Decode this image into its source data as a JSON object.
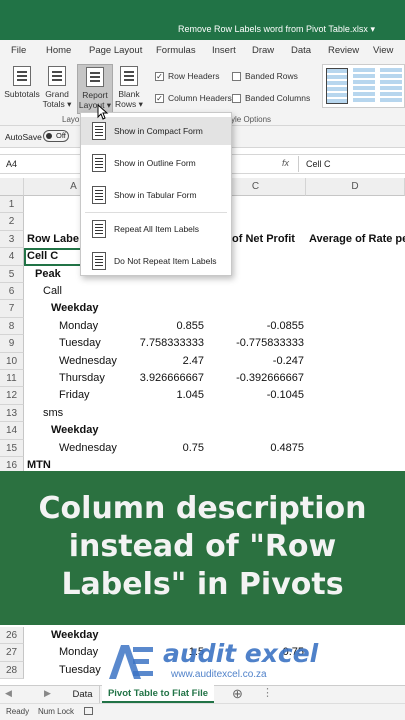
{
  "window": {
    "title": "Remove Row Labels word from Pivot Table.xlsx",
    "title_caret": "▾"
  },
  "menu": [
    "File",
    "Home",
    "Page Layout",
    "Formulas",
    "Insert",
    "Draw",
    "Data",
    "Review",
    "View"
  ],
  "ribbon": {
    "buttons": [
      {
        "line1": "Subtotals",
        "line2": ""
      },
      {
        "line1": "Grand",
        "line2": "Totals ▾"
      },
      {
        "line1": "Report",
        "line2": "Layout ▾"
      },
      {
        "line1": "Blank",
        "line2": "Rows ▾"
      }
    ],
    "layout_group_label": "Layo",
    "options_group_label": "yle Options",
    "checkboxes": [
      {
        "label": "Row Headers",
        "checked": true
      },
      {
        "label": "Banded Rows",
        "checked": false
      },
      {
        "label": "Column Headers",
        "checked": true
      },
      {
        "label": "Banded Columns",
        "checked": false
      }
    ]
  },
  "autosave": {
    "label": "AutoSave",
    "state": "Off"
  },
  "formula_bar": {
    "name_box": "A4",
    "fx": "fx",
    "value": "Cell C"
  },
  "dropdown": {
    "items": [
      "Show in Compact Form",
      "Show in Outline Form",
      "Show in Tabular Form",
      "Repeat All Item Labels",
      "Do Not Repeat Item Labels"
    ]
  },
  "columns": [
    "A",
    "C",
    "D"
  ],
  "rows": [
    {
      "n": "1",
      "a": "",
      "b": "",
      "c": "",
      "d": "",
      "indent": 0,
      "bold": false
    },
    {
      "n": "2",
      "a": "",
      "b": "",
      "c": "",
      "d": "",
      "indent": 0,
      "bold": false
    },
    {
      "n": "3",
      "a": "Row Labe",
      "b": "",
      "c": "of Net Profit",
      "d": "Average of Rate pe",
      "indent": 0,
      "bold": true
    },
    {
      "n": "4",
      "a": "Cell C",
      "b": "",
      "c": "",
      "d": "",
      "indent": 0,
      "bold": true
    },
    {
      "n": "5",
      "a": "Peak",
      "b": "",
      "c": "",
      "d": "",
      "indent": 1,
      "bold": true
    },
    {
      "n": "6",
      "a": "Call",
      "b": "",
      "c": "",
      "d": "",
      "indent": 2,
      "bold": false
    },
    {
      "n": "7",
      "a": "Weekday",
      "b": "",
      "c": "",
      "d": "",
      "indent": 3,
      "bold": true
    },
    {
      "n": "8",
      "a": "Monday",
      "b": "0.855",
      "c": "-0.0855",
      "d": "",
      "indent": 4,
      "bold": false
    },
    {
      "n": "9",
      "a": "Tuesday",
      "b": "7.758333333",
      "c": "-0.775833333",
      "d": "",
      "indent": 4,
      "bold": false
    },
    {
      "n": "10",
      "a": "Wednesday",
      "b": "2.47",
      "c": "-0.247",
      "d": "",
      "indent": 4,
      "bold": false
    },
    {
      "n": "11",
      "a": "Thursday",
      "b": "3.926666667",
      "c": "-0.392666667",
      "d": "",
      "indent": 4,
      "bold": false
    },
    {
      "n": "12",
      "a": "Friday",
      "b": "1.045",
      "c": "-0.1045",
      "d": "",
      "indent": 4,
      "bold": false
    },
    {
      "n": "13",
      "a": "sms",
      "b": "",
      "c": "",
      "d": "",
      "indent": 2,
      "bold": false
    },
    {
      "n": "14",
      "a": "Weekday",
      "b": "",
      "c": "",
      "d": "",
      "indent": 3,
      "bold": true
    },
    {
      "n": "15",
      "a": "Wednesday",
      "b": "0.75",
      "c": "0.4875",
      "d": "",
      "indent": 4,
      "bold": false
    },
    {
      "n": "16",
      "a": "MTN",
      "b": "",
      "c": "",
      "d": "",
      "indent": 0,
      "bold": true
    }
  ],
  "banner": {
    "line1": "Column description",
    "line2": "instead of \"Row",
    "line3": "Labels\" in Pivots"
  },
  "lower_rows": [
    {
      "n": "26",
      "a": "Weekday",
      "b": "",
      "c": "",
      "indent": 3,
      "bold": true
    },
    {
      "n": "27",
      "a": "Monday",
      "b": "1.5",
      "c": "0.75",
      "indent": 4,
      "bold": false
    },
    {
      "n": "28",
      "a": "Tuesday",
      "b": "",
      "c": "",
      "indent": 4,
      "bold": false
    }
  ],
  "watermark": {
    "brand": "audit excel",
    "url": "www.auditexcel.co.za"
  },
  "sheets": [
    {
      "label": "Data",
      "active": false
    },
    {
      "label": "Pivot Table to Flat File",
      "active": true
    }
  ],
  "status": {
    "ready": "Ready",
    "numlock": "Num Lock"
  },
  "colors": {
    "excel_green": "#217346",
    "banner_green": "#2b7140",
    "watermark_blue": "#3d74c4"
  }
}
